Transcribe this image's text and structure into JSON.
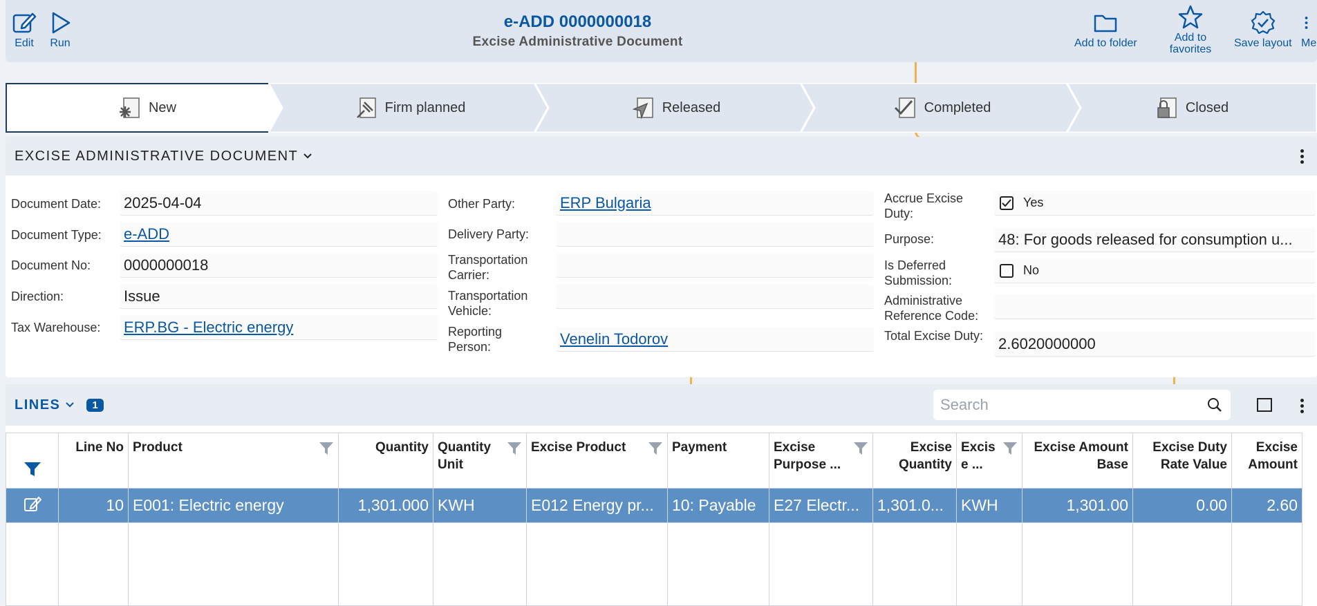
{
  "toolbar": {
    "edit": "Edit",
    "run": "Run",
    "add_to_folder": "Add to folder",
    "add_to_favorites": "Add to favorites",
    "save_layout": "Save layout",
    "more": "Me"
  },
  "header": {
    "title": "e-ADD 0000000018",
    "subtitle": "Excise Administrative Document"
  },
  "states": [
    {
      "label": "New",
      "icon": "new-state-icon",
      "active": true
    },
    {
      "label": "Firm planned",
      "icon": "pin-icon",
      "active": false
    },
    {
      "label": "Released",
      "icon": "paper-plane-icon",
      "active": false
    },
    {
      "label": "Completed",
      "icon": "checkmark-icon",
      "active": false
    },
    {
      "label": "Closed",
      "icon": "lock-icon",
      "active": false
    }
  ],
  "document": {
    "section_title": "EXCISE ADMINISTRATIVE DOCUMENT",
    "col1": [
      {
        "label": "Document Date:",
        "value": "2025-04-04"
      },
      {
        "label": "Document Type:",
        "value": "e-ADD"
      },
      {
        "label": "Document No:",
        "value": "0000000018"
      },
      {
        "label": "Direction:",
        "value": "Issue"
      },
      {
        "label": "Tax Warehouse:",
        "value": "ERP.BG - Electric energy"
      }
    ],
    "col2": [
      {
        "label": "Other Party:",
        "value": "ERP Bulgaria"
      },
      {
        "label": "Delivery Party:",
        "value": ""
      },
      {
        "label": "Transportation Carrier:",
        "value": ""
      },
      {
        "label": "Transportation Vehicle:",
        "value": ""
      },
      {
        "label": "Reporting Person:",
        "value": "Venelin Todorov"
      }
    ],
    "col3": [
      {
        "label": "Accrue Excise Duty:",
        "value": "Yes"
      },
      {
        "label": "Purpose:",
        "value": "48: For goods released for consumption u..."
      },
      {
        "label": "Is Deferred Submission:",
        "value": "No"
      },
      {
        "label": "Administrative Reference Code:",
        "value": ""
      },
      {
        "label": "Total Excise Duty:",
        "value": "2.6020000000"
      }
    ]
  },
  "lines": {
    "title": "LINES",
    "count": "1",
    "search_placeholder": "Search",
    "columns": [
      "Line No",
      "Product",
      "Quantity",
      "Quantity Unit",
      "Excise Product",
      "Payment",
      "Excise Purpose ...",
      "Excise Quantity",
      "Excis e ...",
      "Excise Amount Base",
      "Excise Duty Rate Value",
      "Excise Amount"
    ],
    "rows": [
      [
        "10",
        "E001: Electric energy",
        "1,301.000",
        "KWH",
        "E012 Energy pr...",
        "10: Payable",
        "E27 Electr...",
        "1,301.0...",
        "KWH",
        "1,301.00",
        "0.00",
        "2.60"
      ]
    ]
  },
  "colors": {
    "accent": "#0a57a4",
    "selected_row": "#5c8fc4",
    "background_line": "#f3b249"
  }
}
